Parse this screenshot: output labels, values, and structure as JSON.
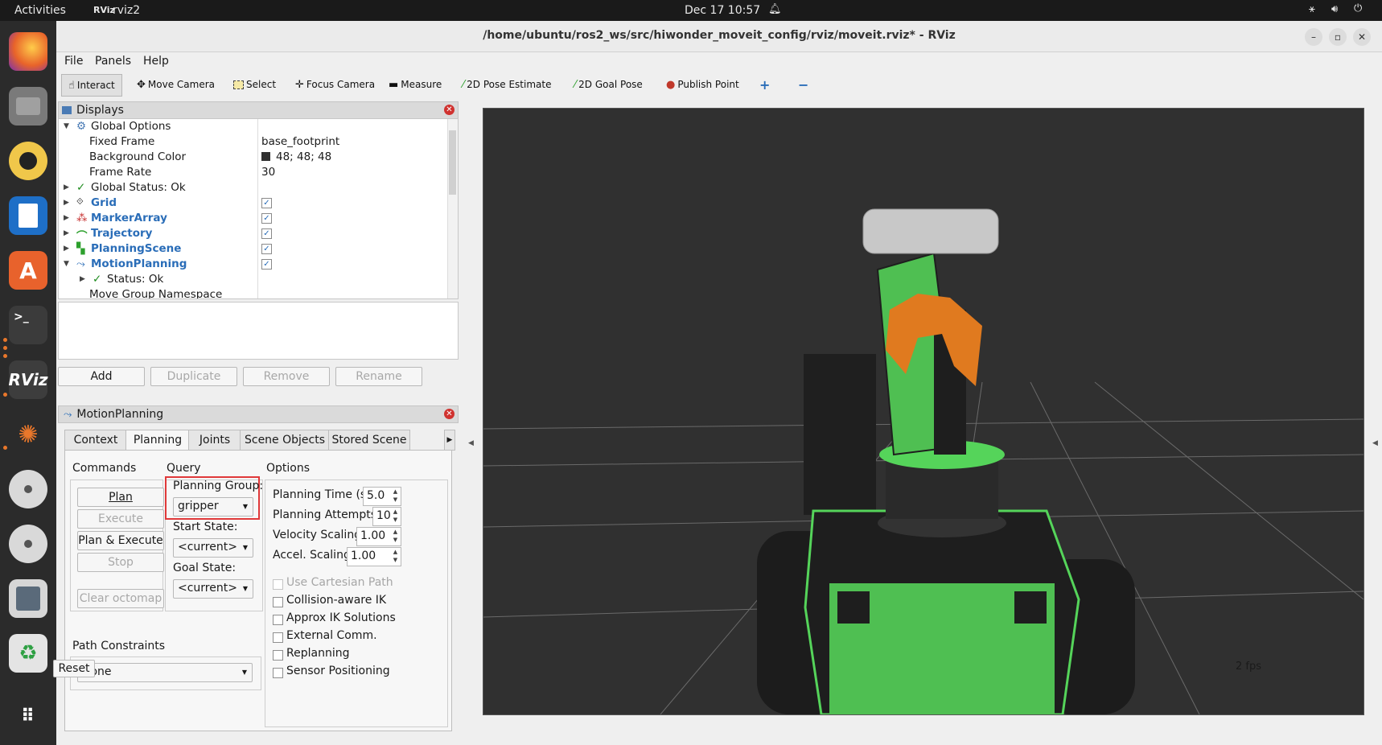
{
  "topbar": {
    "activities": "Activities",
    "app": "rviz2",
    "clock": "Dec 17  10:57"
  },
  "dock": {
    "items": [
      {
        "name": "firefox",
        "color": "#e8632a"
      },
      {
        "name": "files",
        "color": "#7a7a7a"
      },
      {
        "name": "rhythmbox",
        "color": "#e0a526"
      },
      {
        "name": "libreoffice-writer",
        "color": "#1e6fc7"
      },
      {
        "name": "app-center",
        "color": "#e8622c"
      },
      {
        "name": "terminal",
        "color": "#3b3b3b"
      },
      {
        "name": "rviz",
        "label": "RViz",
        "color": "#3d3d3d"
      },
      {
        "name": "ros-tool",
        "color": "#2b2b2b"
      },
      {
        "name": "disc-1",
        "color": "#d9d9d9"
      },
      {
        "name": "disc-2",
        "color": "#d9d9d9"
      },
      {
        "name": "save",
        "color": "#d6d6d6"
      },
      {
        "name": "trash",
        "color": "#e4e4e4"
      }
    ]
  },
  "window": {
    "title": "/home/ubuntu/ros2_ws/src/hiwonder_moveit_config/rviz/moveit.rviz* - RViz"
  },
  "menu": {
    "file": "File",
    "panels": "Panels",
    "help": "Help"
  },
  "toolbar": {
    "interact": "Interact",
    "move_camera": "Move Camera",
    "select": "Select",
    "focus_camera": "Focus Camera",
    "measure": "Measure",
    "pose_estimate": "2D Pose Estimate",
    "goal_pose": "2D Goal Pose",
    "publish_point": "Publish Point"
  },
  "displays": {
    "title": "Displays",
    "global_options": "Global Options",
    "fixed_frame": {
      "label": "Fixed Frame",
      "value": "base_footprint"
    },
    "background_color": {
      "label": "Background Color",
      "value": "48; 48; 48",
      "swatch": "#303030"
    },
    "frame_rate": {
      "label": "Frame Rate",
      "value": "30"
    },
    "global_status": "Global Status: Ok",
    "items": [
      {
        "label": "Grid",
        "checked": true
      },
      {
        "label": "MarkerArray",
        "checked": true
      },
      {
        "label": "Trajectory",
        "checked": true
      },
      {
        "label": "PlanningScene",
        "checked": true
      },
      {
        "label": "MotionPlanning",
        "checked": true
      }
    ],
    "status_ok": "Status: Ok",
    "move_group_namespace": "Move Group Namespace",
    "buttons": {
      "add": "Add",
      "duplicate": "Duplicate",
      "remove": "Remove",
      "rename": "Rename"
    }
  },
  "motion_planning": {
    "title": "MotionPlanning",
    "tabs": [
      "Context",
      "Planning",
      "Joints",
      "Scene Objects",
      "Stored Scene"
    ],
    "commands": {
      "heading": "Commands",
      "plan": "Plan",
      "execute": "Execute",
      "plan_execute": "Plan & Execute",
      "stop": "Stop",
      "clear_octomap": "Clear octomap"
    },
    "query": {
      "heading": "Query",
      "planning_group_label": "Planning Group:",
      "planning_group_value": "gripper",
      "start_state_label": "Start State:",
      "start_state_value": "<current>",
      "goal_state_label": "Goal State:",
      "goal_state_value": "<current>"
    },
    "options": {
      "heading": "Options",
      "planning_time": {
        "label": "Planning Time (s):",
        "value": "5.0"
      },
      "planning_attempts": {
        "label": "Planning Attempts:",
        "value": "10"
      },
      "velocity_scaling": {
        "label": "Velocity Scaling:",
        "value": "1.00"
      },
      "accel_scaling": {
        "label": "Accel. Scaling:",
        "value": "1.00"
      },
      "checkboxes": [
        "Use Cartesian Path",
        "Collision-aware IK",
        "Approx IK Solutions",
        "External Comm.",
        "Replanning",
        "Sensor Positioning"
      ]
    },
    "path_constraints": {
      "label": "Path Constraints",
      "value": "None"
    }
  },
  "bottom": {
    "reset": "Reset",
    "fps": "2 fps"
  },
  "colors": {
    "highlight": "#e0393a",
    "robot_green": "#55d45a",
    "gripper_orange": "#e07a1f",
    "viewport_bg": "#303030"
  }
}
